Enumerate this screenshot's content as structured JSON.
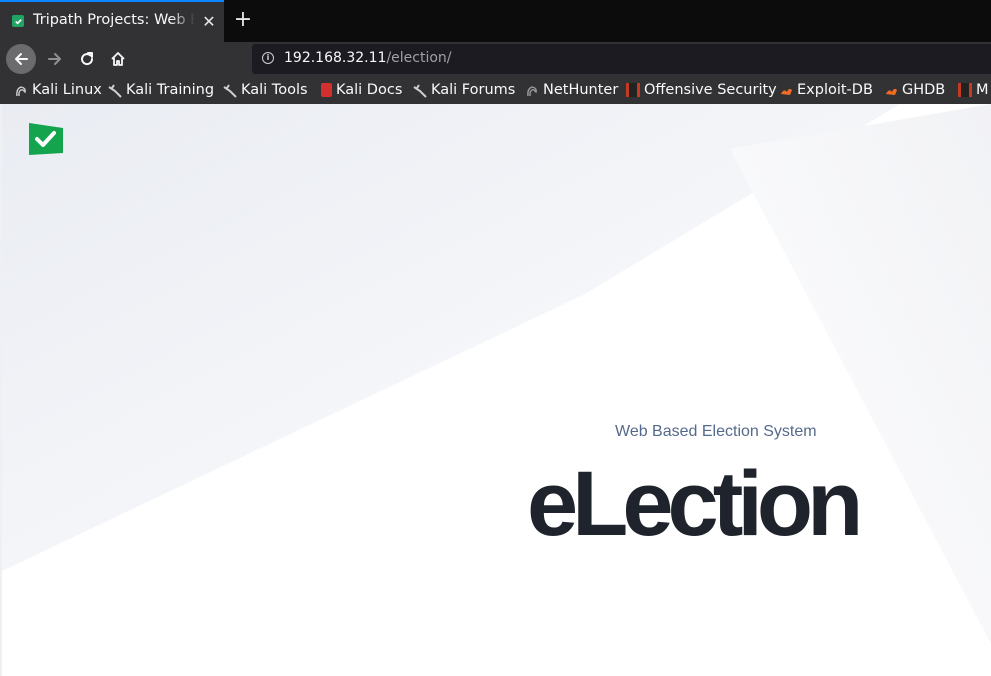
{
  "browser": {
    "tab": {
      "title": "Tripath Projects: Web Based Election System",
      "close_symbol": "✕"
    },
    "new_tab_symbol": "+",
    "url": {
      "host": "192.168.32.11",
      "path": "/election/"
    },
    "bookmarks": [
      {
        "label": "Kali Linux",
        "icon": "kali-dragon-icon"
      },
      {
        "label": "Kali Training",
        "icon": "kali-dragon-icon"
      },
      {
        "label": "Kali Tools",
        "icon": "kali-dragon-icon"
      },
      {
        "label": "Kali Docs",
        "icon": "kali-docs-icon"
      },
      {
        "label": "Kali Forums",
        "icon": "kali-dragon-icon"
      },
      {
        "label": "NetHunter",
        "icon": "nethunter-icon"
      },
      {
        "label": "Offensive Security",
        "icon": "offsec-icon"
      },
      {
        "label": "Exploit-DB",
        "icon": "exploitdb-icon"
      },
      {
        "label": "GHDB",
        "icon": "exploitdb-icon"
      },
      {
        "label": "M",
        "icon": "offsec-icon"
      }
    ]
  },
  "page": {
    "subtitle": "Web Based Election System",
    "brand": "eLection",
    "colors": {
      "logo": "#14a44d",
      "text": "#1f232b",
      "subtitle": "#55698c"
    }
  }
}
